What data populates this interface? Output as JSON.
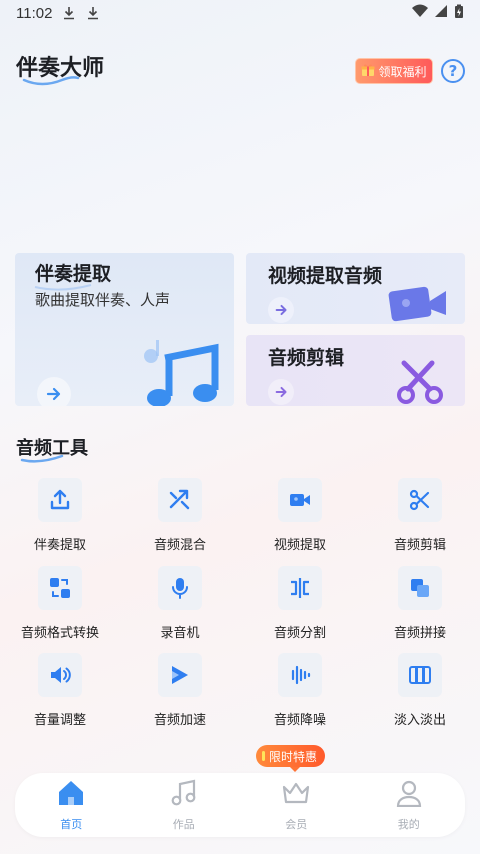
{
  "status_bar": {
    "time": "11:02"
  },
  "header": {
    "app_title": "伴奏大师",
    "welfare_label": "领取福利",
    "help_label": "?"
  },
  "cards": {
    "accompaniment": {
      "title": "伴奏提取",
      "subtitle": "歌曲提取伴奏、人声"
    },
    "video_audio": {
      "title": "视频提取音频"
    },
    "audio_edit": {
      "title": "音频剪辑"
    }
  },
  "tools_section": {
    "title": "音频工具"
  },
  "tools": [
    {
      "label": "伴奏提取",
      "icon": "upload-icon"
    },
    {
      "label": "音频混合",
      "icon": "shuffle-icon"
    },
    {
      "label": "视频提取",
      "icon": "video-camera-icon"
    },
    {
      "label": "音频剪辑",
      "icon": "scissors-icon"
    },
    {
      "label": "音频格式转换",
      "icon": "format-convert-icon"
    },
    {
      "label": "录音机",
      "icon": "microphone-icon"
    },
    {
      "label": "音频分割",
      "icon": "split-icon"
    },
    {
      "label": "音频拼接",
      "icon": "join-icon"
    },
    {
      "label": "音量调整",
      "icon": "volume-icon"
    },
    {
      "label": "音频加速",
      "icon": "speed-icon"
    },
    {
      "label": "音频降噪",
      "icon": "denoise-icon"
    },
    {
      "label": "淡入淡出",
      "icon": "fade-icon"
    }
  ],
  "promo_badge": "限时特惠",
  "bottom_nav": [
    {
      "label": "首页",
      "icon": "home-icon",
      "active": true
    },
    {
      "label": "作品",
      "icon": "music-note-icon",
      "active": false
    },
    {
      "label": "会员",
      "icon": "crown-icon",
      "active": false
    },
    {
      "label": "我的",
      "icon": "user-icon",
      "active": false
    }
  ],
  "colors": {
    "accent": "#3a8ef0",
    "promo": "#ff5a2c",
    "card_icon": "#6a78e8"
  }
}
